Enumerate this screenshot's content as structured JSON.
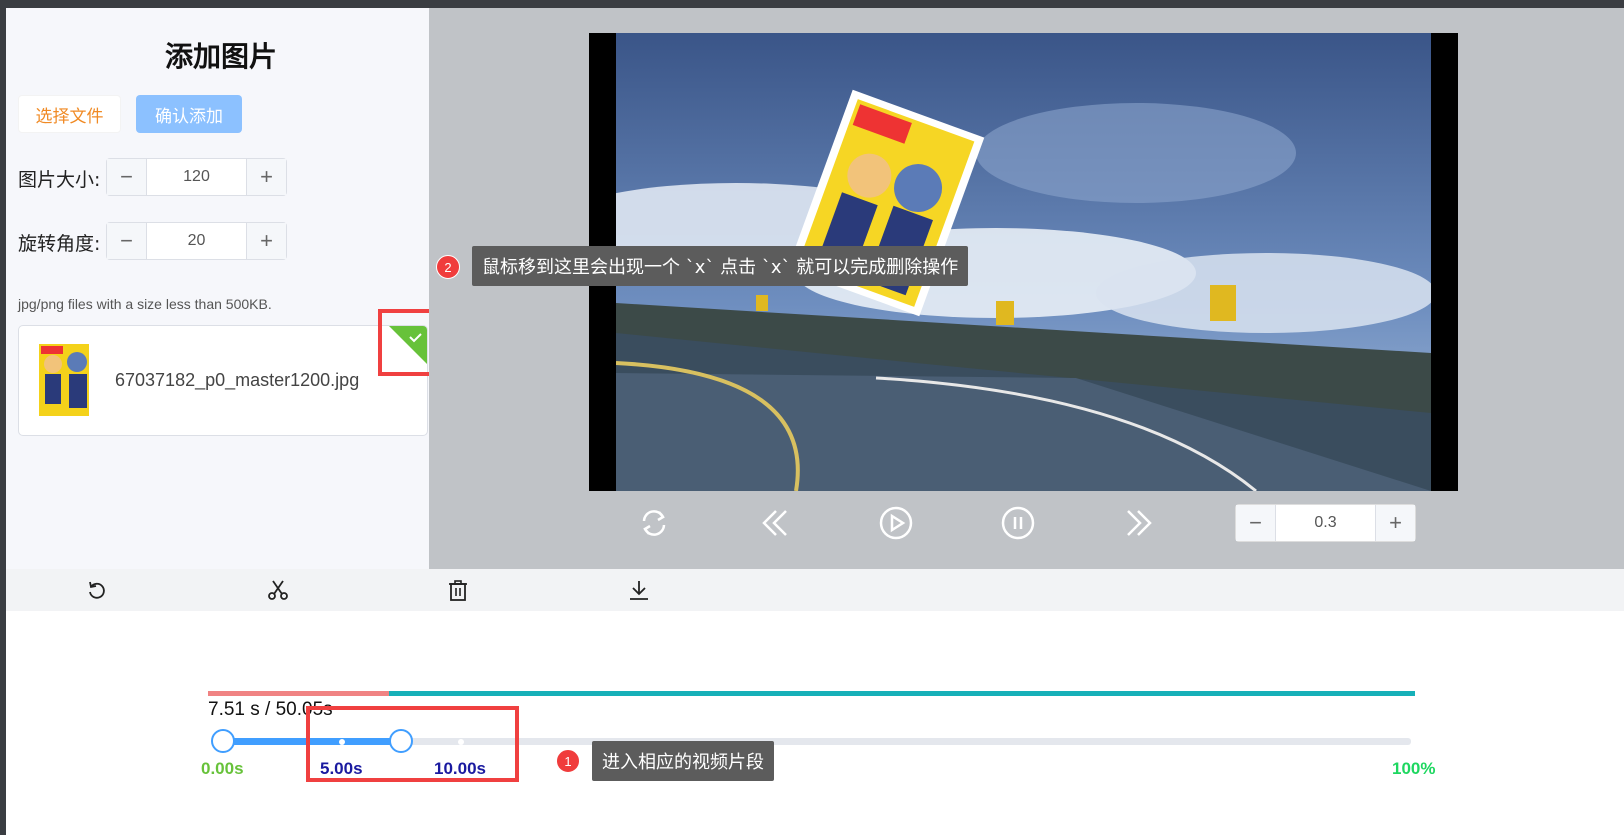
{
  "left": {
    "title": "添加图片",
    "select_file_label": "选择文件",
    "confirm_add_label": "确认添加",
    "size_label": "图片大小:",
    "size_value": "120",
    "rotation_label": "旋转角度:",
    "rotation_value": "20",
    "upload_tip": "jpg/png files with a size less than 500KB.",
    "file_name": "67037182_p0_master1200.jpg"
  },
  "annotations": {
    "tip1_number": "1",
    "tip1_text": "进入相应的视频片段",
    "tip2_number": "2",
    "tip2_text": "鼠标移到这里会出现一个 `x` 点击 `x` 就可以完成删除操作"
  },
  "player": {
    "speed_value": "0.3",
    "controls": [
      "replay-icon",
      "rewind-icon",
      "play-icon",
      "pause-icon",
      "fast-forward-icon"
    ]
  },
  "toolbar": {
    "icons": [
      "undo-icon",
      "scissors-icon",
      "trash-icon",
      "download-icon"
    ]
  },
  "timeline": {
    "time_readout": "7.51 s / 50.05s",
    "progress_fraction": 0.15,
    "marks": {
      "start": "0.00s",
      "m1": "5.00s",
      "m2": "10.00s",
      "end": "100%"
    },
    "colors": {
      "progress_played": "#f08383",
      "progress_remaining": "#16b0b8",
      "slider_active": "#409eff",
      "mark_start": "#67c23a",
      "mark_segment": "#1a1aa0",
      "mark_end": "#1ed760",
      "annotation_box": "#f04040"
    }
  }
}
